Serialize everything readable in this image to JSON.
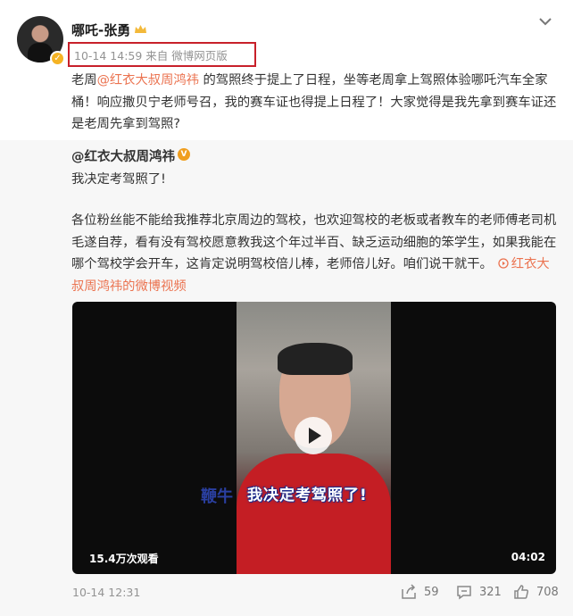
{
  "post": {
    "username": "哪吒-张勇",
    "meta": "10-14 14:59  来自 微博网页版",
    "text_part1": "老周",
    "mention": "@红衣大叔周鸿祎",
    "text_part2": " 的驾照终于提上了日程，坐等老周拿上驾照体验哪吒汽车全家桶！响应撒贝宁老师号召，我的赛车证也得提上日程了！大家觉得是我先拿到赛车证还是老周先拿到驾照?"
  },
  "repost": {
    "author": "@红衣大叔周鸿祎",
    "line1": "我决定考驾照了!",
    "body": "各位粉丝能不能给我推荐北京周边的驾校，也欢迎驾校的老板或者教车的老师傅老司机毛遂自荐，看有没有驾校愿意教我这个年过半百、缺乏运动细胞的笨学生，如果我能在哪个驾校学会开车，这肯定说明驾校倍儿棒，老师倍儿好。咱们说干就干。",
    "link_text": "红衣大叔周鸿祎的微博视频",
    "video": {
      "subtitle_left": "鞭牛",
      "subtitle": "我决定考驾照了!",
      "views": "15.4万次观看",
      "duration": "04:02"
    },
    "time": "10-14 12:31",
    "shares": "59",
    "comments": "321",
    "likes": "708"
  },
  "icons": {
    "verified": "verified-badge-icon",
    "crown": "crown-icon",
    "chevron": "chevron-down-icon",
    "share": "share-icon",
    "comment": "comment-icon",
    "like": "thumbs-up-icon"
  },
  "colors": {
    "accent_link": "#eb7350",
    "highlight_box": "#c8202a",
    "repost_bg": "#f7f7f7"
  }
}
